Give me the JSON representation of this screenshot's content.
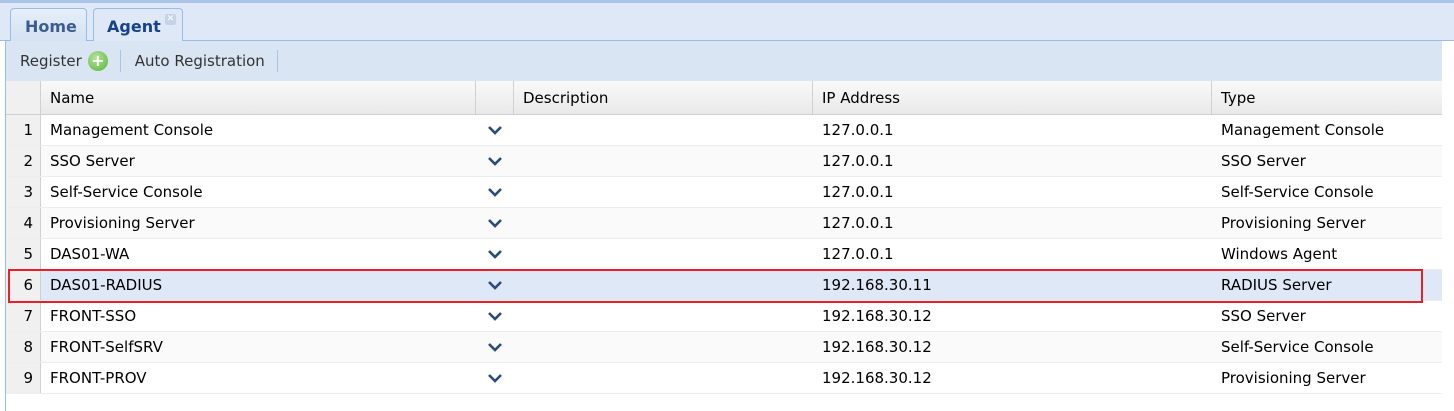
{
  "tabs": [
    {
      "label": "Home"
    },
    {
      "label": "Agent",
      "close_icon": "close-icon"
    }
  ],
  "toolbar": {
    "register_label": "Register",
    "auto_registration_label": "Auto Registration"
  },
  "grid": {
    "columns": {
      "name": "Name",
      "description": "Description",
      "ip": "IP Address",
      "type": "Type"
    },
    "rows": [
      {
        "num": "1",
        "name": "Management Console",
        "description": "",
        "ip": "127.0.0.1",
        "type": "Management Console"
      },
      {
        "num": "2",
        "name": "SSO Server",
        "description": "",
        "ip": "127.0.0.1",
        "type": "SSO Server"
      },
      {
        "num": "3",
        "name": "Self-Service Console",
        "description": "",
        "ip": "127.0.0.1",
        "type": "Self-Service Console"
      },
      {
        "num": "4",
        "name": "Provisioning Server",
        "description": "",
        "ip": "127.0.0.1",
        "type": "Provisioning Server"
      },
      {
        "num": "5",
        "name": "DAS01-WA",
        "description": "",
        "ip": "127.0.0.1",
        "type": "Windows Agent"
      },
      {
        "num": "6",
        "name": "DAS01-RADIUS",
        "description": "",
        "ip": "192.168.30.11",
        "type": "RADIUS Server",
        "selected": true
      },
      {
        "num": "7",
        "name": "FRONT-SSO",
        "description": "",
        "ip": "192.168.30.12",
        "type": "SSO Server"
      },
      {
        "num": "8",
        "name": "FRONT-SelfSRV",
        "description": "",
        "ip": "192.168.30.12",
        "type": "Self-Service Console"
      },
      {
        "num": "9",
        "name": "FRONT-PROV",
        "description": "",
        "ip": "192.168.30.12",
        "type": "Provisioning Server"
      }
    ]
  },
  "colors": {
    "highlight": "#e8202a",
    "selected_row": "#dfe8f6"
  }
}
